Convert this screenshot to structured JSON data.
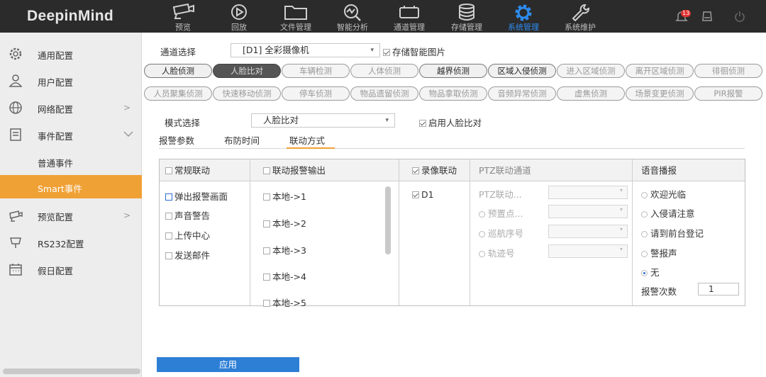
{
  "brand": "DeepinMind",
  "nav": [
    {
      "label": "预览",
      "icon": "camera-icon"
    },
    {
      "label": "回放",
      "icon": "playback-icon"
    },
    {
      "label": "文件管理",
      "icon": "folder-icon"
    },
    {
      "label": "智能分析",
      "icon": "analysis-icon"
    },
    {
      "label": "通道管理",
      "icon": "channel-icon"
    },
    {
      "label": "存储管理",
      "icon": "database-icon"
    },
    {
      "label": "系统管理",
      "icon": "gear-icon"
    },
    {
      "label": "系统维护",
      "icon": "wrench-icon"
    }
  ],
  "topright": {
    "bell_count": "13",
    "icons": [
      "bell-icon",
      "device-icon",
      "power-icon"
    ]
  },
  "sidebar": {
    "items": [
      {
        "label": "通用配置",
        "icon": "gear-icon"
      },
      {
        "label": "用户配置",
        "icon": "user-icon"
      },
      {
        "label": "网络配置",
        "icon": "globe-icon"
      },
      {
        "label": "事件配置",
        "icon": "event-icon"
      },
      {
        "label": "普通事件"
      },
      {
        "label": "Smart事件"
      },
      {
        "label": "预览配置",
        "icon": "preview-icon"
      },
      {
        "label": "RS232配置",
        "icon": "rs232-icon"
      },
      {
        "label": "假日配置",
        "icon": "calendar-icon"
      }
    ]
  },
  "channel": {
    "label": "通道选择",
    "value": "[D1] 全彩摄像机",
    "store_label": "存储智能图片"
  },
  "event_tabs_row1": [
    "人脸侦测",
    "人脸比对",
    "车辆检测",
    "人体侦测",
    "越界侦测",
    "区域入侵侦测",
    "进入区域侦测",
    "离开区域侦测",
    "徘徊侦测"
  ],
  "event_tabs_row2": [
    "人员聚集侦测",
    "快速移动侦测",
    "停车侦测",
    "物品遗留侦测",
    "物品拿取侦测",
    "音频异常侦测",
    "虚焦侦测",
    "场景变更侦测",
    "PIR报警"
  ],
  "mode": {
    "label": "模式选择",
    "value": "人脸比对",
    "enable_label": "启用人脸比对"
  },
  "subtabs": [
    "报警参数",
    "布防时间",
    "联动方式"
  ],
  "linkage": {
    "normal": {
      "header": "常规联动",
      "items": [
        "弹出报警画面",
        "声音警告",
        "上传中心",
        "发送邮件"
      ]
    },
    "alarm_out": {
      "header": "联动报警输出",
      "items": [
        "本地->1",
        "本地->2",
        "本地->3",
        "本地->4",
        "本地->5"
      ]
    },
    "record": {
      "header": "录像联动",
      "items": [
        "D1"
      ]
    },
    "ptz": {
      "header": "PTZ联动通道",
      "rows": [
        "PTZ联动...",
        "预置点...",
        "巡航序号",
        "轨迹号"
      ]
    },
    "voice": {
      "header": "语音播报",
      "options": [
        "欢迎光临",
        "入侵请注意",
        "请到前台登记",
        "警报声",
        "无"
      ],
      "selected": "无",
      "count_label": "报警次数",
      "count_value": "1"
    }
  },
  "apply_label": "应用"
}
